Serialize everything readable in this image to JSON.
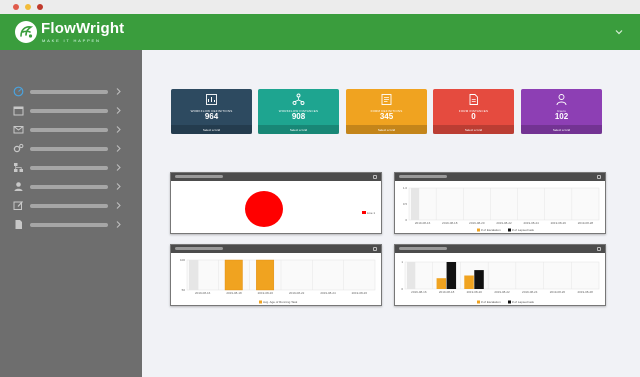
{
  "window": {
    "dots": [
      {
        "name": "close-dot",
        "color": "#e05b4b"
      },
      {
        "name": "minimize-dot",
        "color": "#f2bc3a"
      },
      {
        "name": "maximize-dot",
        "color": "#c0392b"
      }
    ]
  },
  "header": {
    "brand": "FlowWright",
    "tagline": "MAKE IT HAPPEN",
    "background": "#3a9d3d",
    "chevron_icon": "chevron-down-icon"
  },
  "sidebar": {
    "items": [
      {
        "icon": "dashboard-icon"
      },
      {
        "icon": "calendar-icon"
      },
      {
        "icon": "envelope-icon"
      },
      {
        "icon": "cogs-icon"
      },
      {
        "icon": "sitemap-icon"
      },
      {
        "icon": "user-icon"
      },
      {
        "icon": "edit-icon"
      },
      {
        "icon": "document-icon"
      }
    ]
  },
  "cards": [
    {
      "label": "WORKFLOW DEFINITIONS",
      "value": "964",
      "footer": "Select a Grid",
      "color": "#2d4a60",
      "icon": "workflow-icon"
    },
    {
      "label": "WORKFLOW INSTANCES",
      "value": "908",
      "footer": "Select a Grid",
      "color": "#1ea590",
      "icon": "network-icon"
    },
    {
      "label": "FORM DEFINITIONS",
      "value": "345",
      "footer": "Select a Grid",
      "color": "#f0a320",
      "icon": "form-icon"
    },
    {
      "label": "FORM INSTANCES",
      "value": "0",
      "footer": "Select a Grid",
      "color": "#e54b3f",
      "icon": "document-icon"
    },
    {
      "label": "Users",
      "value": "102",
      "footer": "Select a Grid",
      "color": "#8d3fb4",
      "icon": "user-icon"
    }
  ],
  "panels": {
    "pie": {
      "legend": "Live 1",
      "color": "#ff0000"
    },
    "top_right": {
      "y_ticks": [
        "1.0",
        "0.5",
        "0"
      ],
      "x_ticks": [
        "2019-08-16",
        "2019-08-18",
        "2019-08-20",
        "2019-08-22",
        "2019-08-24",
        "2019-08-26",
        "2019-08-28"
      ],
      "legend": [
        "# of Escalation",
        "# of Lapsed task"
      ]
    },
    "bottom_left": {
      "y_ticks": [
        "100",
        "50"
      ],
      "x_ticks": [
        "2019-08-16",
        "2019-08-18",
        "2019-08-20",
        "2019-08-22",
        "2019-08-24",
        "2019-08-26"
      ],
      "legend": "Avg. Age of Running Task"
    },
    "bottom_right": {
      "y_ticks": [
        "1",
        "0"
      ],
      "x_ticks": [
        "2019-08-16",
        "2019-08-18",
        "2019-08-20",
        "2019-08-22",
        "2019-08-24",
        "2019-08-26",
        "2019-08-28"
      ],
      "legend": [
        "# of Escalation",
        "# of Lapsed task"
      ]
    }
  },
  "chart_data": [
    {
      "type": "pie",
      "categories": [
        "Live 1"
      ],
      "values": [
        100
      ]
    },
    {
      "type": "bar",
      "categories": [
        "2019-08-16",
        "2019-08-18",
        "2019-08-20",
        "2019-08-22",
        "2019-08-24",
        "2019-08-26",
        "2019-08-28"
      ],
      "series": [
        {
          "name": "# of Escalation",
          "values": [
            0,
            0,
            0,
            0,
            0,
            0,
            0
          ]
        },
        {
          "name": "# of Lapsed task",
          "values": [
            0,
            0,
            0,
            0,
            0,
            0,
            0
          ]
        }
      ],
      "ylim": [
        0,
        1
      ]
    },
    {
      "type": "bar",
      "categories": [
        "2019-08-16",
        "2019-08-18",
        "2019-08-20",
        "2019-08-22",
        "2019-08-24",
        "2019-08-26"
      ],
      "series": [
        {
          "name": "Avg. Age of Running Task",
          "values": [
            0,
            100,
            100,
            0,
            0,
            0
          ]
        }
      ],
      "ylim": [
        0,
        100
      ]
    },
    {
      "type": "bar",
      "categories": [
        "2019-08-16",
        "2019-08-18",
        "2019-08-20",
        "2019-08-22",
        "2019-08-24",
        "2019-08-26",
        "2019-08-28"
      ],
      "series": [
        {
          "name": "# of Escalation",
          "values": [
            0,
            0.4,
            0.5,
            0,
            0,
            0,
            0
          ]
        },
        {
          "name": "# of Lapsed task",
          "values": [
            0,
            1,
            0.7,
            0,
            0,
            0,
            0
          ]
        }
      ],
      "ylim": [
        0,
        1
      ]
    }
  ]
}
